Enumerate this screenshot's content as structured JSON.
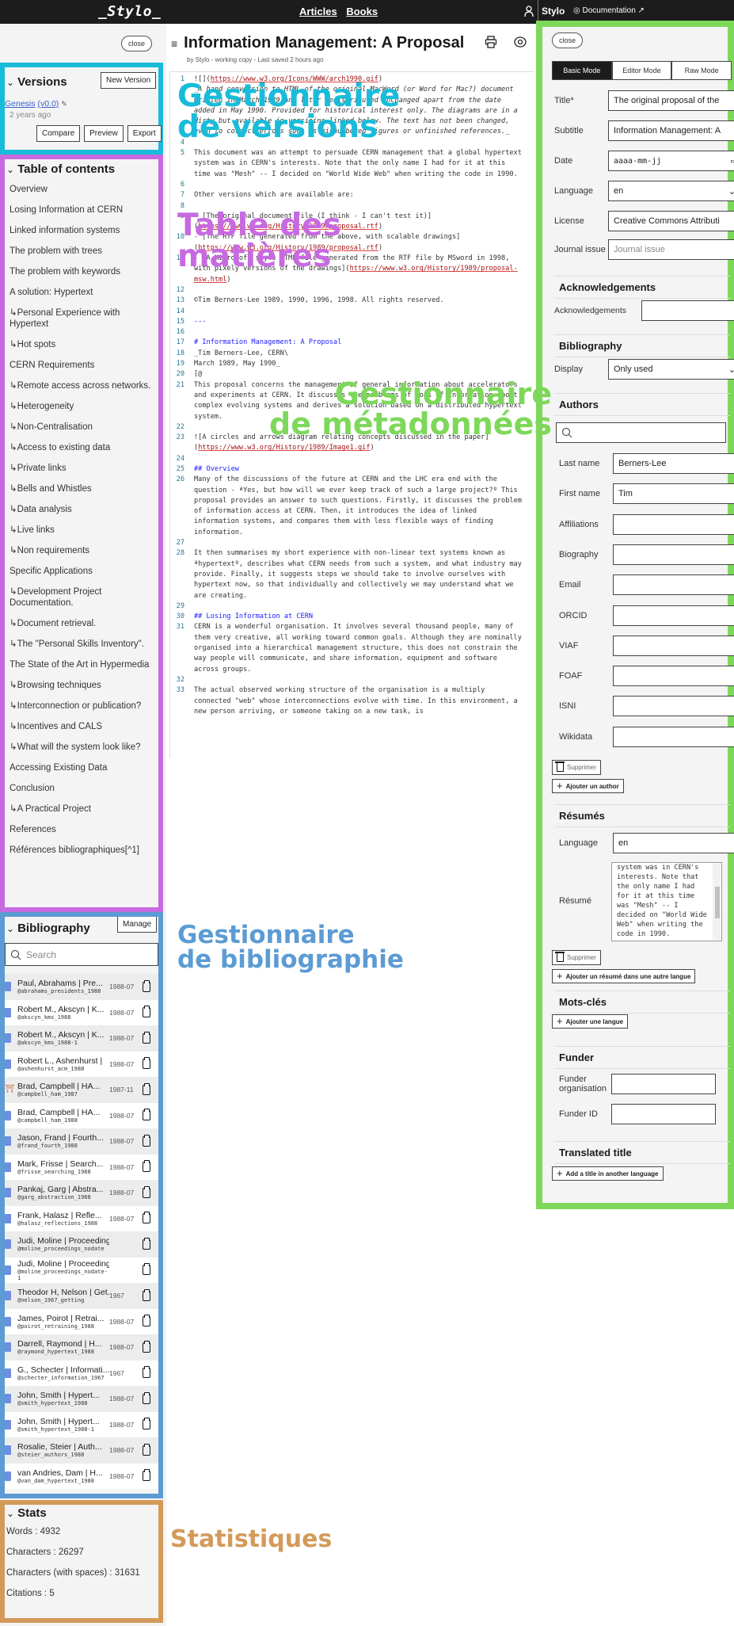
{
  "topbar": {
    "logo": "_Stylo_",
    "nav": [
      "Articles",
      "Books"
    ],
    "brand": "Stylo",
    "documentation": "Documentation ↗"
  },
  "left": {
    "close_label": "close",
    "versions": {
      "title": "Versions",
      "new_version": "New Version",
      "version_name": "Genesis",
      "version_number": "(v0.0)",
      "version_age": "2 years ago",
      "buttons": [
        "Compare",
        "Preview",
        "Export"
      ]
    },
    "toc": {
      "title": "Table of contents",
      "items": [
        "Overview",
        "Losing Information at CERN",
        "Linked information systems",
        "The problem with trees",
        "The problem with keywords",
        "A solution: Hypertext",
        "↳Personal Experience with Hypertext",
        "↳Hot spots",
        "CERN Requirements",
        "↳Remote access across networks.",
        "↳Heterogeneity",
        "↳Non-Centralisation",
        "↳Access to existing data",
        "↳Private links",
        "↳Bells and Whistles",
        "↳Data analysis",
        "↳Live links",
        "↳Non requirements",
        "Specific Applications",
        "↳Development Project Documentation.",
        "↳Document retrieval.",
        "↳The \"Personal Skills Inventory\".",
        "The State of the Art in Hypermedia",
        "↳Browsing techniques",
        "↳Interconnection or publication?",
        "↳Incentives and CALS",
        "↳What will the system look like?",
        "Accessing Existing Data",
        "Conclusion",
        "↳A Practical Project",
        "References",
        "Références bibliographiques[^1]"
      ]
    },
    "bibliography": {
      "title": "Bibliography",
      "manage": "Manage",
      "search_placeholder": "Search",
      "entries": [
        {
          "title": "Paul, Abrahams | Pre...",
          "key": "@abrahams_presidents_1988",
          "date": "1988-07",
          "type": "book"
        },
        {
          "title": "Robert M., Akscyn | K...",
          "key": "@akscyn_kms_1988",
          "date": "1988-07",
          "type": "book"
        },
        {
          "title": "Robert M., Akscyn | K...",
          "key": "@akscyn_kms_1988-1",
          "date": "1988-07",
          "type": "book"
        },
        {
          "title": "Robert L., Ashenhurst |",
          "key": "@ashenhurst_acm_1988",
          "date": "1988-07",
          "type": "book"
        },
        {
          "title": "Brad, Campbell | HA...",
          "key": "@campbell_ham_1987",
          "date": "1987-11",
          "type": "institution"
        },
        {
          "title": "Brad, Campbell | HA...",
          "key": "@campbell_ham_1988",
          "date": "1988-07",
          "type": "book"
        },
        {
          "title": "Jason, Frand | Fourth...",
          "key": "@frand_fourth_1988",
          "date": "1988-07",
          "type": "book"
        },
        {
          "title": "Mark, Frisse | Search...",
          "key": "@frisse_searching_1988",
          "date": "1988-07",
          "type": "book"
        },
        {
          "title": "Pankaj, Garg | Abstra...",
          "key": "@garg_abstraction_1988",
          "date": "1988-07",
          "type": "book"
        },
        {
          "title": "Frank, Halasz | Refle...",
          "key": "@halasz_reflections_1988",
          "date": "1988-07",
          "type": "book"
        },
        {
          "title": "Judi, Moline | Proceedings ...",
          "key": "@moline_proceedings_nodate",
          "date": "",
          "type": "book"
        },
        {
          "title": "Judi, Moline | Proceedings ...",
          "key": "@moline_proceedings_nodate-1",
          "date": "",
          "type": "book"
        },
        {
          "title": "Theodor H, Nelson | Get...",
          "key": "@nelson_1967_getting",
          "date": "1967",
          "type": "book"
        },
        {
          "title": "James, Poirot | Retrai...",
          "key": "@poirot_retraining_1988",
          "date": "1988-07",
          "type": "book"
        },
        {
          "title": "Darrell, Raymond | H...",
          "key": "@raymond_hypertext_1988",
          "date": "1988-07",
          "type": "book"
        },
        {
          "title": "G., Schecter | Informati...",
          "key": "@schecter_information_1967",
          "date": "1967",
          "type": "book"
        },
        {
          "title": "John, Smith | Hypert...",
          "key": "@smith_hypertext_1988",
          "date": "1988-07",
          "type": "book"
        },
        {
          "title": "John, Smith | Hypert...",
          "key": "@smith_hypertext_1988-1",
          "date": "1988-07",
          "type": "book"
        },
        {
          "title": "Rosalie, Steier | Auth...",
          "key": "@steier_authors_1988",
          "date": "1988-07",
          "type": "book"
        },
        {
          "title": "van Andries, Dam | H...",
          "key": "@van_dam_hypertext_1988",
          "date": "1988-07",
          "type": "book"
        }
      ]
    },
    "stats": {
      "title": "Stats",
      "lines": [
        "Words : 4932",
        "Characters : 26297",
        "Characters (with spaces) : 31631",
        "Citations : 5"
      ]
    }
  },
  "editor": {
    "title": "Information Management: A Proposal",
    "subtitle": "by Stylo - working copy - Last saved 2 hours ago",
    "lines": [
      {
        "n": "1",
        "t": "![](",
        "u": "https://www.w3.org/Icons/WWW/arch1990.gif",
        "e": ")",
        "s": ""
      },
      {
        "n": "3",
        "t": "_A hand conversion to HTML of the original MacWord (or Word for Mac?) document written in March 1989 and later redistributed unchanged apart from the date added in May 1990. Provided for historical interest only. The diagrams are in a dirty but available in versioins linked below. The text has not been changed, even to correct errors such as misnumbered figures or unfinished references._",
        "s": "em"
      },
      {
        "n": "4",
        "t": "",
        "s": ""
      },
      {
        "n": "5",
        "t": "This document was an attempt to persuade CERN management that a global hypertext system was in CERN's interests. Note that the only name I had for it at this time was \"Mesh\" -- I decided on \"World Wide Web\" when writing the code in 1990.",
        "s": ""
      },
      {
        "n": "6",
        "t": "",
        "s": ""
      },
      {
        "n": "7",
        "t": "Other versions which are available are:",
        "s": ""
      },
      {
        "n": "8",
        "t": "",
        "s": ""
      },
      {
        "n": "9",
        "t": "- [The original document file (I think - I can't test it)](",
        "u": "https://www.w3.org/History/1989/proposal.rtf",
        "e": ")",
        "s": ""
      },
      {
        "n": "10",
        "t": "- [The RTF file generated from the above, with scalable drawings](",
        "u": "https://www.w3.org/History/1989/proposal.rtf",
        "e": ")",
        "s": ""
      },
      {
        "n": "11",
        "t": "- [A Microsoft style HTML file generated from the RTF file by MSword in 1998, with pixely versions of the drawings](",
        "u": "https://www.w3.org/History/1989/proposal-msw.html",
        "e": ")",
        "s": ""
      },
      {
        "n": "12",
        "t": "",
        "s": ""
      },
      {
        "n": "13",
        "t": "©Tim Berners-Lee 1989, 1990, 1996, 1998. All rights reserved.",
        "s": ""
      },
      {
        "n": "14",
        "t": "",
        "s": ""
      },
      {
        "n": "15",
        "t": "---",
        "s": "hd"
      },
      {
        "n": "16",
        "t": "",
        "s": ""
      },
      {
        "n": "17",
        "t": "# Information Management: A Proposal",
        "s": "hd"
      },
      {
        "n": "18",
        "t": "_Tim Berners-Lee, CERN\\",
        "s": ""
      },
      {
        "n": "19",
        "t": "March 1989, May 1990_",
        "s": ""
      },
      {
        "n": "20",
        "t": "[@",
        "s": ""
      },
      {
        "n": "21",
        "t": "This proposal concerns the management of general information about accelerators and experiments at CERN. It discusses the problems of loss of information about complex evolving systems and derives a solution based on a distributed hypertext system.",
        "s": ""
      },
      {
        "n": "22",
        "t": "",
        "s": ""
      },
      {
        "n": "23",
        "t": "![A circles and arrows diagram relating concepts discussed in the paper](",
        "u": "https://www.w3.org/History/1989/Image1.gif",
        "e": ")",
        "s": ""
      },
      {
        "n": "24",
        "t": "",
        "s": ""
      },
      {
        "n": "25",
        "t": "## Overview",
        "s": "hd"
      },
      {
        "n": "26",
        "t": "Many of the discussions of the future at CERN and the LHC era end with the question - ªYes, but how will we ever keep track of such a large project?º This proposal provides an answer to such questions. Firstly, it discusses the problem of information access at CERN. Then, it introduces the idea of linked information systems, and compares them with less flexible ways of finding information.",
        "s": ""
      },
      {
        "n": "27",
        "t": "",
        "s": ""
      },
      {
        "n": "28",
        "t": "It then summarises my short experience with non-linear text systems known as ªhypertextº, describes what CERN needs from such a system, and what industry may provide. Finally, it suggests steps we should take to involve ourselves with hypertext now, so that individually and collectively we may understand what we are creating.",
        "s": ""
      },
      {
        "n": "29",
        "t": "",
        "s": ""
      },
      {
        "n": "30",
        "t": "## Losing Information at CERN",
        "s": "hd"
      },
      {
        "n": "31",
        "t": "CERN is a wonderful organisation. It involves several thousand people, many of them very creative, all working toward common goals. Although they are nominally organised into a hierarchical management structure, this does not constrain the way people will communicate, and share information, equipment and software across groups.",
        "s": ""
      },
      {
        "n": "32",
        "t": "",
        "s": ""
      },
      {
        "n": "33",
        "t": "The actual observed working structure of the organisation is a multiply connected \"web\" whose interconnections evolve with time. In this environment, a new person arriving, or someone taking on a new task, is",
        "s": ""
      }
    ]
  },
  "metadata": {
    "close_label": "close",
    "modes": [
      "Basic Mode",
      "Editor Mode",
      "Raw Mode"
    ],
    "active_mode": "Basic Mode",
    "basic": {
      "title_label": "Title*",
      "title_value": "The original proposal of the",
      "subtitle_label": "Subtitle",
      "subtitle_value": "Information Management: A",
      "date_label": "Date",
      "date_placeholder": "aaaa-mm-jj",
      "language_label": "Language",
      "language_value": "en",
      "license_label": "License",
      "license_value": "Creative Commons Attributi",
      "journal_label": "Journal issue",
      "journal_placeholder": "Journal issue"
    },
    "acknowledgements": {
      "heading": "Acknowledgements",
      "label": "Acknowledgements",
      "value": ""
    },
    "bibliography": {
      "heading": "Bibliography",
      "label": "Display",
      "value": "Only used"
    },
    "authors": {
      "heading": "Authors",
      "fields": [
        {
          "label": "Last name",
          "value": "Berners-Lee"
        },
        {
          "label": "First name",
          "value": "Tim"
        },
        {
          "label": "Affiliations",
          "value": ""
        },
        {
          "label": "Biography",
          "value": ""
        },
        {
          "label": "Email",
          "value": ""
        },
        {
          "label": "ORCID",
          "value": ""
        },
        {
          "label": "VIAF",
          "value": ""
        },
        {
          "label": "FOAF",
          "value": ""
        },
        {
          "label": "ISNI",
          "value": ""
        },
        {
          "label": "Wikidata",
          "value": ""
        }
      ],
      "delete_label": "Supprimer",
      "add_label": "Ajouter un author"
    },
    "resumes": {
      "heading": "Résumés",
      "language_label": "Language",
      "language_value": "en",
      "resume_label": "Résumé",
      "resume_value": "system was in CERN's interests. Note that the only name I had for it at this time was \"Mesh\" -- I decided on \"World Wide Web\" when writing the code in 1990.",
      "delete_label": "Supprimer",
      "add_label": "Ajouter un résumé dans une autre langue"
    },
    "keywords": {
      "heading": "Mots-clés",
      "add_label": "Ajouter une langue"
    },
    "funder": {
      "heading": "Funder",
      "org_label": "Funder organisation",
      "org_value": "",
      "id_label": "Funder ID",
      "id_value": ""
    },
    "translated_title": {
      "heading": "Translated title",
      "add_label": "Add a title in another language"
    }
  },
  "annotations": {
    "versions": [
      "Gestionnaire",
      "de versions"
    ],
    "toc": [
      "Table des",
      "matières"
    ],
    "metadata": [
      "Gestionnaire",
      "de métadonnées"
    ],
    "bibliography": [
      "Gestionnaire",
      "de bibliographie"
    ],
    "stats": "Statistiques"
  },
  "colors": {
    "versions": "#18bcd9",
    "toc": "#c76ae0",
    "metadata": "#7dd85a",
    "bibliography": "#5c9bd4",
    "stats": "#d49a5a"
  }
}
